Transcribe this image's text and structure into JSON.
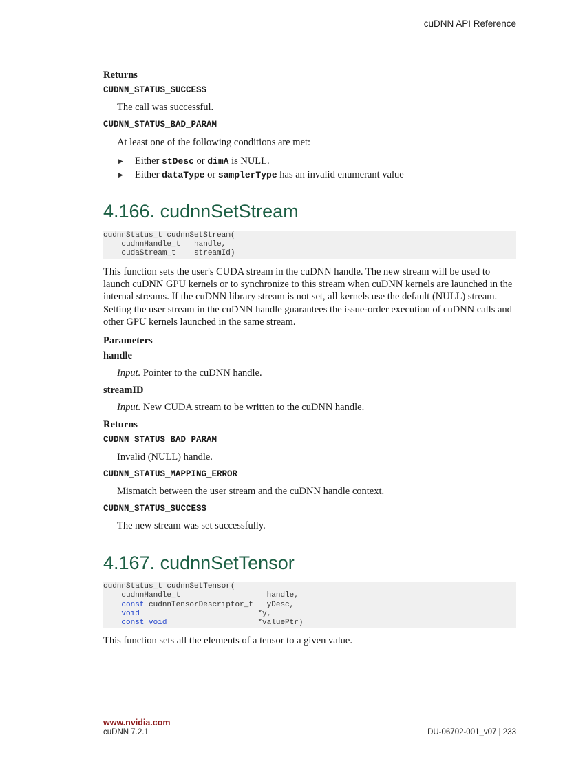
{
  "header": {
    "title": "cuDNN API Reference"
  },
  "prev": {
    "returns_label": "Returns",
    "ret1": {
      "code": "CUDNN_STATUS_SUCCESS",
      "desc": "The call was successful."
    },
    "ret2": {
      "code": "CUDNN_STATUS_BAD_PARAM",
      "desc": "At least one of the following conditions are met:",
      "bullets": [
        {
          "pre": "Either ",
          "c1": "stDesc",
          "mid": " or ",
          "c2": "dimA",
          "post": " is NULL."
        },
        {
          "pre": "Either ",
          "c1": "dataType",
          "mid": " or ",
          "c2": "samplerType",
          "post": " has an invalid enumerant value"
        }
      ]
    }
  },
  "sec166": {
    "title": "4.166. cudnnSetStream",
    "code": [
      "cudnnStatus_t cudnnSetStream(",
      "    cudnnHandle_t   handle,",
      "    cudaStream_t    streamId)"
    ],
    "description": "This function sets the user's CUDA stream in the cuDNN handle. The new stream will be used to launch cuDNN GPU kernels or to synchronize to this stream when cuDNN kernels are launched in the internal streams. If the cuDNN library stream is not set, all kernels use the default (NULL) stream. Setting the user stream in the cuDNN handle guarantees the issue-order execution of cuDNN calls and other GPU kernels launched in the same stream.",
    "params_label": "Parameters",
    "params": [
      {
        "name": "handle",
        "kind": "Input.",
        "desc": " Pointer to the cuDNN handle."
      },
      {
        "name": "streamID",
        "kind": "Input.",
        "desc": " New CUDA stream to be written to the cuDNN handle."
      }
    ],
    "returns_label": "Returns",
    "returns": [
      {
        "code": "CUDNN_STATUS_BAD_PARAM",
        "desc": "Invalid (NULL) handle."
      },
      {
        "code": "CUDNN_STATUS_MAPPING_ERROR",
        "desc": "Mismatch between the user stream and the cuDNN handle context."
      },
      {
        "code": "CUDNN_STATUS_SUCCESS",
        "desc": "The new stream was set successfully."
      }
    ]
  },
  "sec167": {
    "title": "4.167. cudnnSetTensor",
    "code": {
      "l1": "cudnnStatus_t cudnnSetTensor(",
      "l2": "    cudnnHandle_t                   handle,",
      "l3_kw": "const",
      "l3_rest": " cudnnTensorDescriptor_t   yDesc,",
      "l4_kw": "void",
      "l4_rest": "                          *y,",
      "l5_kw": "const void",
      "l5_rest": "                    *valuePtr)"
    },
    "description": "This function sets all the elements of a tensor to a given value."
  },
  "footer": {
    "url": "www.nvidia.com",
    "version": "cuDNN 7.2.1",
    "doc": "DU-06702-001_v07 | 233"
  }
}
